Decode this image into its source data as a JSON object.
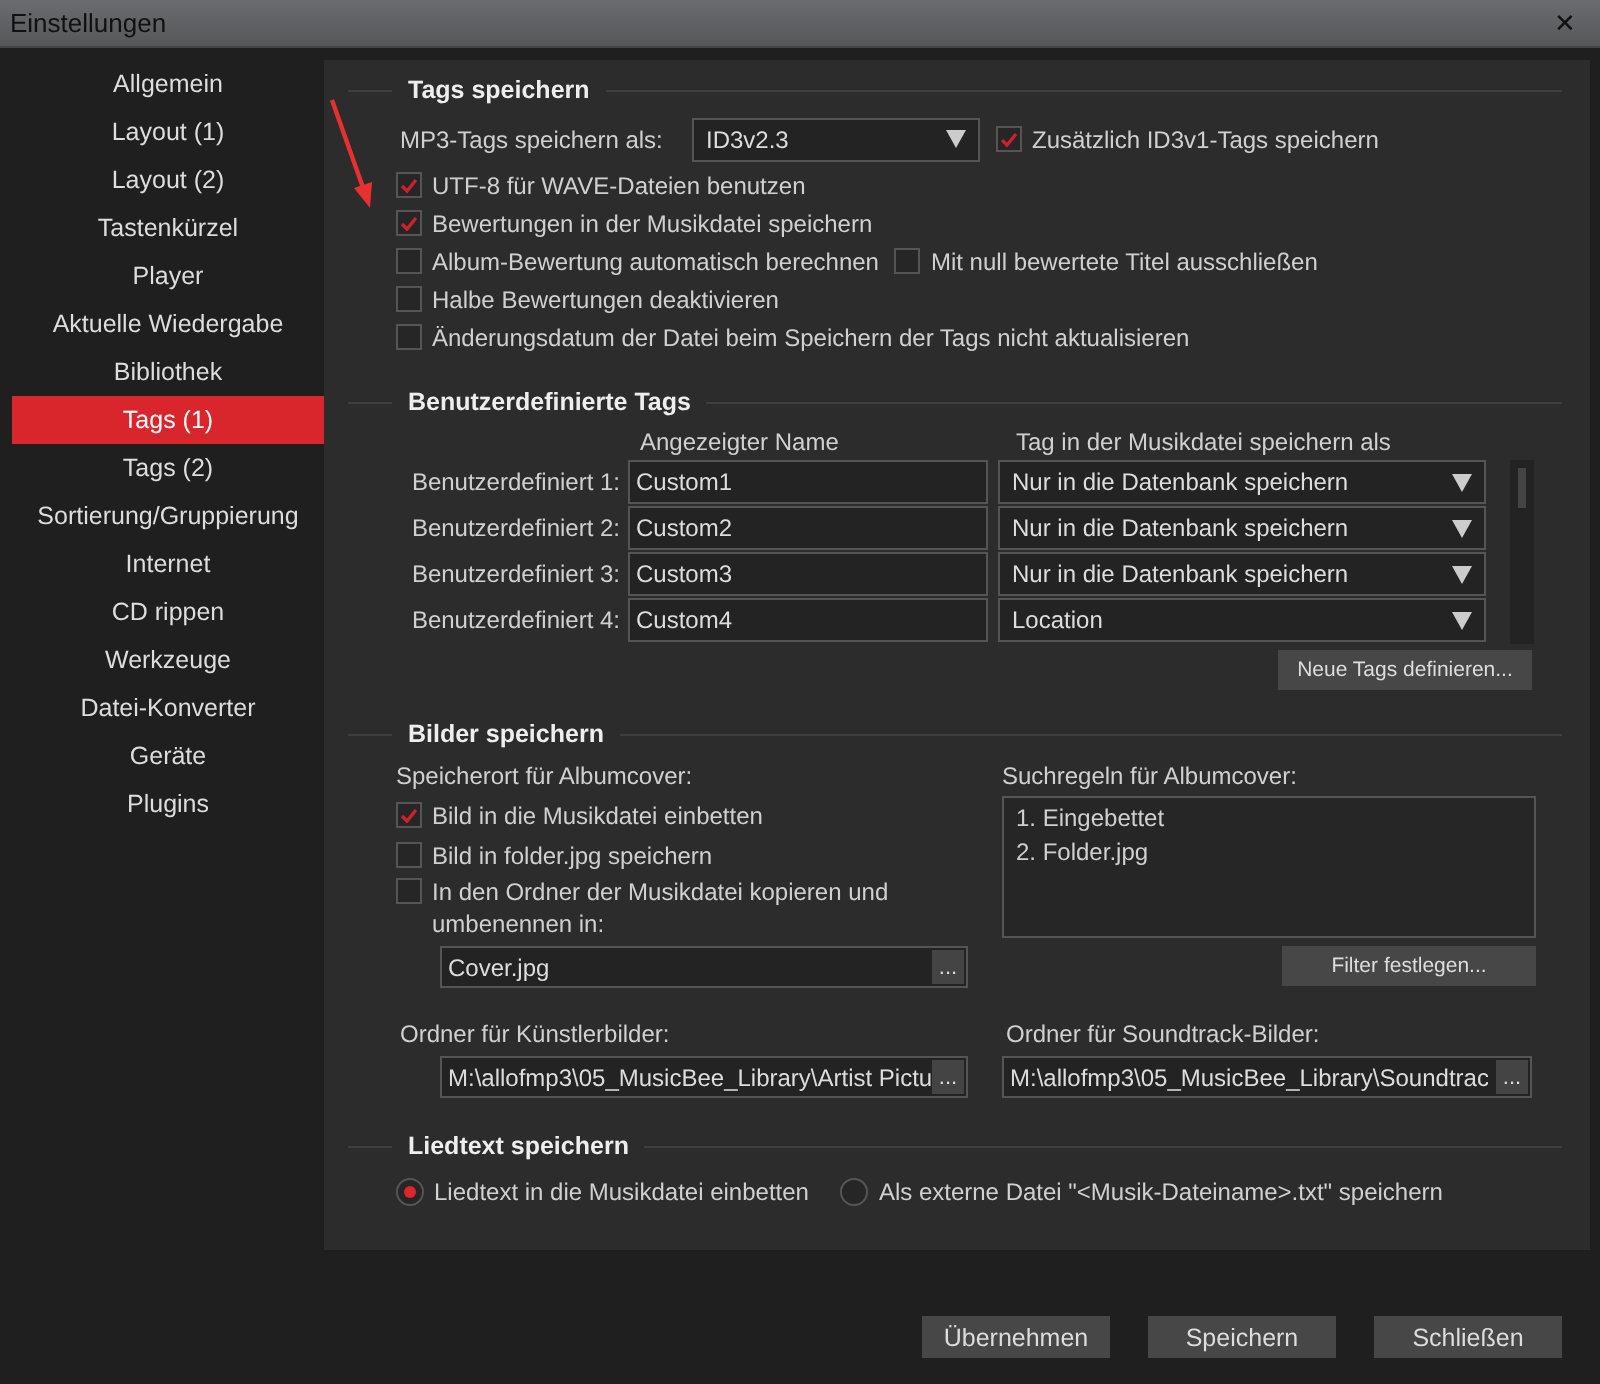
{
  "window": {
    "title": "Einstellungen",
    "close": "✕"
  },
  "sidebar": {
    "items": [
      {
        "label": "Allgemein",
        "selected": false
      },
      {
        "label": "Layout (1)",
        "selected": false
      },
      {
        "label": "Layout (2)",
        "selected": false
      },
      {
        "label": "Tastenkürzel",
        "selected": false
      },
      {
        "label": "Player",
        "selected": false
      },
      {
        "label": "Aktuelle Wiedergabe",
        "selected": false
      },
      {
        "label": "Bibliothek",
        "selected": false
      },
      {
        "label": "Tags (1)",
        "selected": true
      },
      {
        "label": "Tags (2)",
        "selected": false
      },
      {
        "label": "Sortierung/Gruppierung",
        "selected": false
      },
      {
        "label": "Internet",
        "selected": false
      },
      {
        "label": "CD rippen",
        "selected": false
      },
      {
        "label": "Werkzeuge",
        "selected": false
      },
      {
        "label": "Datei-Konverter",
        "selected": false
      },
      {
        "label": "Geräte",
        "selected": false
      },
      {
        "label": "Plugins",
        "selected": false
      }
    ]
  },
  "tags_section": {
    "title": "Tags speichern",
    "format_label": "MP3-Tags speichern als:",
    "format_value": "ID3v2.3",
    "format_option": {
      "label": "Zusätzlich ID3v1-Tags speichern",
      "checked": true
    },
    "rows": [
      {
        "options": [
          {
            "label": "UTF-8 für WAVE-Dateien benutzen",
            "checked": true
          }
        ]
      },
      {
        "options": [
          {
            "label": "Bewertungen in der Musikdatei speichern",
            "checked": true
          }
        ]
      },
      {
        "options": [
          {
            "label": "Album-Bewertung automatisch berechnen",
            "checked": false
          },
          {
            "label": "Mit null bewertete Titel ausschließen",
            "checked": false
          }
        ]
      },
      {
        "options": [
          {
            "label": "Halbe Bewertungen deaktivieren",
            "checked": false
          }
        ]
      },
      {
        "options": [
          {
            "label": "Änderungsdatum der Datei beim Speichern der Tags nicht aktualisieren",
            "checked": false
          }
        ]
      }
    ]
  },
  "custom_tags": {
    "title": "Benutzerdefinierte Tags",
    "columns": [
      "Angezeigter Name",
      "Tag in der Musikdatei speichern als"
    ],
    "rows": [
      {
        "label": "Benutzerdefiniert 1:",
        "name": "Custom1",
        "save_as": "Nur in die Datenbank speichern"
      },
      {
        "label": "Benutzerdefiniert 2:",
        "name": "Custom2",
        "save_as": "Nur in die Datenbank speichern"
      },
      {
        "label": "Benutzerdefiniert 3:",
        "name": "Custom3",
        "save_as": "Nur in die Datenbank speichern"
      },
      {
        "label": "Benutzerdefiniert 4:",
        "name": "Custom4",
        "save_as": "Location"
      }
    ],
    "button": "Neue Tags definieren..."
  },
  "images": {
    "title": "Bilder speichern",
    "location_label": "Speicherort für Albumcover:",
    "options": [
      {
        "label": "Bild in die Musikdatei einbetten",
        "checked": true
      },
      {
        "label": "Bild in folder.jpg speichern",
        "checked": false
      },
      {
        "label": "In den Ordner der Musikdatei kopieren und umbenennen in:",
        "checked": false
      }
    ],
    "filename_value": "Cover.jpg",
    "browse": "...",
    "rules_label": "Suchregeln für Albumcover:",
    "rules": [
      "1. Eingebettet",
      "2. Folder.jpg"
    ],
    "filter_button": "Filter festlegen...",
    "artist_label": "Ordner für Künstlerbilder:",
    "artist_path": "M:\\allofmp3\\05_MusicBee_Library\\Artist Pictu",
    "soundtrack_label": "Ordner für Soundtrack-Bilder:",
    "soundtrack_path": "M:\\allofmp3\\05_MusicBee_Library\\Soundtrac"
  },
  "lyrics": {
    "title": "Liedtext speichern",
    "options": [
      {
        "label": "Liedtext in die Musikdatei einbetten",
        "selected": true
      },
      {
        "label": "Als externe Datei \"<Musik-Dateiname>.txt\" speichern",
        "selected": false
      }
    ]
  },
  "buttons": [
    "Übernehmen",
    "Speichern",
    "Schließen"
  ]
}
